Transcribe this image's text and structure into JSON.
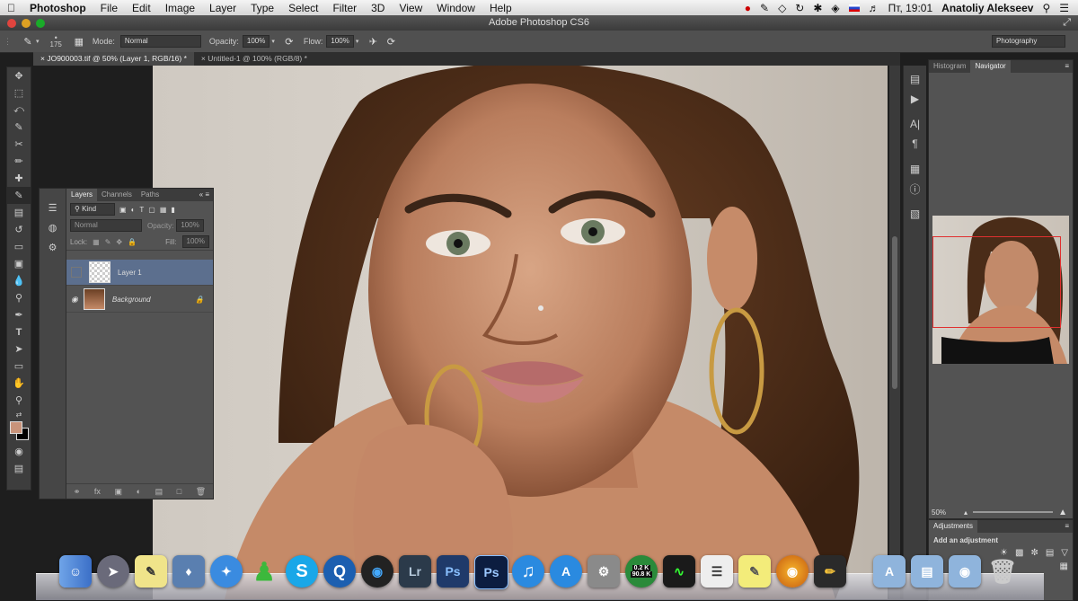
{
  "menubar": {
    "app": "Photoshop",
    "items": [
      "File",
      "Edit",
      "Image",
      "Layer",
      "Type",
      "Select",
      "Filter",
      "3D",
      "View",
      "Window",
      "Help"
    ],
    "clock": "Пт, 19:01",
    "user": "Anatoliy Alekseev"
  },
  "window": {
    "title": "Adobe Photoshop CS6"
  },
  "options": {
    "brush_size": "175",
    "mode_label": "Mode:",
    "mode_value": "Normal",
    "opacity_label": "Opacity:",
    "opacity_value": "100%",
    "flow_label": "Flow:",
    "flow_value": "100%",
    "workspace": "Photography"
  },
  "doc_tabs": [
    {
      "label": "JO900003.tif @ 50% (Layer 1, RGB/16) *"
    },
    {
      "label": "Untitled-1 @ 100% (RGB/8) *"
    }
  ],
  "layers_panel": {
    "tabs": [
      "Layers",
      "Channels",
      "Paths"
    ],
    "filter_kind": "Kind",
    "blend_mode": "Normal",
    "opacity_label": "Opacity:",
    "opacity_value": "100%",
    "lock_label": "Lock:",
    "fill_label": "Fill:",
    "fill_value": "100%",
    "layers": [
      {
        "name": "Layer 1",
        "selected": true
      },
      {
        "name": "Background",
        "selected": false
      }
    ]
  },
  "nav_panel": {
    "tabs": [
      "Histogram",
      "Navigator"
    ],
    "zoom": "50%"
  },
  "adjustments_panel": {
    "title": "Adjustments",
    "subtitle": "Add an adjustment"
  },
  "dock": {
    "utorrent_down": "0.2 K",
    "utorrent_up": "90.8 K",
    "apps": [
      "Finder",
      "Launchpad",
      "Stickies",
      "Preview",
      "Safari",
      "Adium",
      "Skype",
      "QuickTime",
      "iTunes",
      "Lightroom",
      "Photoshop",
      "Photoshop CS6",
      "iTunes",
      "App Store",
      "System Preferences",
      "uTorrent",
      "Activity Monitor",
      "TextEdit",
      "Stickies",
      "Uploader",
      "Pencil",
      "Applications",
      "Documents",
      "Downloads",
      "Trash"
    ]
  },
  "colors": {
    "foreground": "#c8937a",
    "background": "#000000",
    "layer_selected": "#5c6f8e",
    "nav_view_box": "#e03030"
  }
}
